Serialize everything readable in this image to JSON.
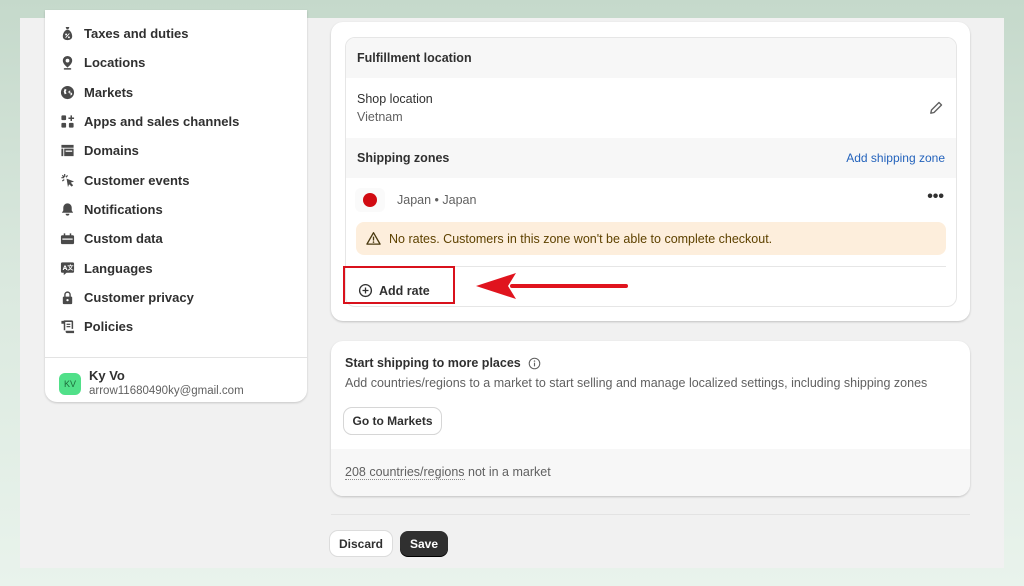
{
  "sidebar": {
    "items": [
      {
        "label": "Taxes and duties",
        "icon": "money-bag-icon"
      },
      {
        "label": "Locations",
        "icon": "location-pin-icon"
      },
      {
        "label": "Markets",
        "icon": "globe-dollar-icon"
      },
      {
        "label": "Apps and sales channels",
        "icon": "apps-icon"
      },
      {
        "label": "Domains",
        "icon": "domain-icon"
      },
      {
        "label": "Customer events",
        "icon": "cursor-click-icon"
      },
      {
        "label": "Notifications",
        "icon": "bell-icon"
      },
      {
        "label": "Custom data",
        "icon": "custom-data-icon"
      },
      {
        "label": "Languages",
        "icon": "language-icon"
      },
      {
        "label": "Customer privacy",
        "icon": "lock-icon"
      },
      {
        "label": "Policies",
        "icon": "policy-icon"
      }
    ],
    "user": {
      "initials": "KV",
      "name": "Ky Vo",
      "email": "arrow11680490ky@gmail.com"
    }
  },
  "shipping_card": {
    "fulfillment_title": "Fulfillment location",
    "shop_location_label": "Shop location",
    "shop_location_value": "Vietnam",
    "zones_title": "Shipping zones",
    "add_zone_label": "Add shipping zone",
    "zone": {
      "name": "Japan • Japan",
      "flag_color": "#d10b12"
    },
    "more_label": "•••",
    "warning_text": "No rates. Customers in this zone won't be able to complete checkout.",
    "add_rate_label": "Add rate"
  },
  "markets_card": {
    "title": "Start shipping to more places",
    "description": "Add countries/regions to a market to start selling and manage localized settings, including shipping zones",
    "button_label": "Go to Markets",
    "footer_link": "208 countries/regions",
    "footer_rest": " not in a market"
  },
  "actions": {
    "discard_label": "Discard",
    "save_label": "Save"
  },
  "annotation": {
    "highlight_color": "#d9111c",
    "target": "Add rate"
  }
}
